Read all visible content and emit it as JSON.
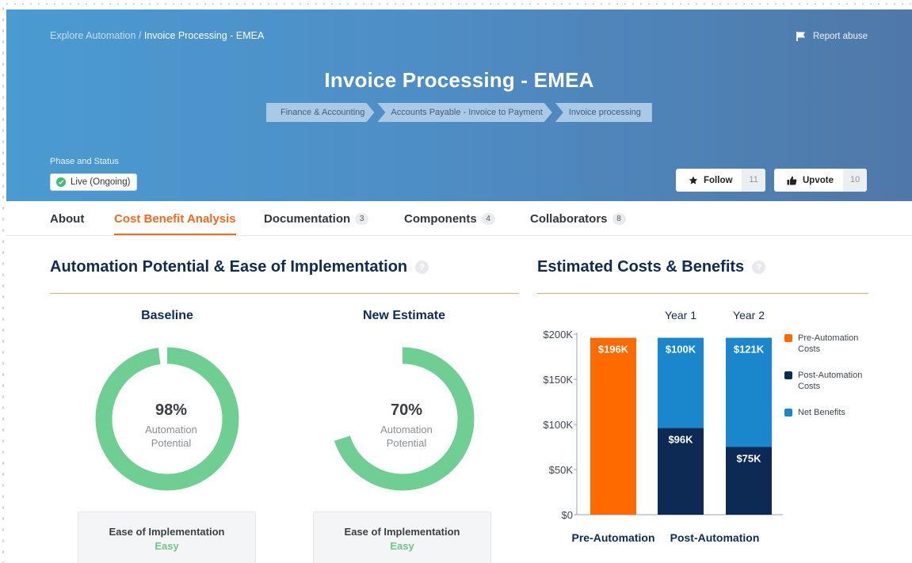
{
  "breadcrumb": {
    "parent": "Explore Automation /",
    "current": "Invoice Processing - EMEA"
  },
  "header": {
    "report_label": "Report abuse",
    "title": "Invoice Processing - EMEA",
    "category_path": [
      "Finance & Accounting",
      "Accounts Payable - Invoice to Payment",
      "Invoice processing"
    ],
    "phase_label": "Phase and Status",
    "status": "Live (Ongoing)",
    "follow": {
      "label": "Follow",
      "count": "11"
    },
    "upvote": {
      "label": "Upvote",
      "count": "10"
    }
  },
  "tabs": [
    {
      "label": "About",
      "badge": ""
    },
    {
      "label": "Cost Benefit Analysis",
      "badge": "",
      "active": true
    },
    {
      "label": "Documentation",
      "badge": "3"
    },
    {
      "label": "Components",
      "badge": "4"
    },
    {
      "label": "Collaborators",
      "badge": "8"
    }
  ],
  "potential": {
    "title": "Automation Potential & Ease of Implementation",
    "help": "?",
    "baseline": {
      "title": "Baseline",
      "percent_text": "98%",
      "percent": 98,
      "caption1": "Automation",
      "caption2": "Potential",
      "ease_label": "Ease of Implementation",
      "ease_value": "Easy"
    },
    "estimate": {
      "title": "New Estimate",
      "percent_text": "70%",
      "percent": 70,
      "caption1": "Automation",
      "caption2": "Potential",
      "ease_label": "Ease of Implementation",
      "ease_value": "Easy"
    }
  },
  "costs": {
    "title": "Estimated Costs & Benefits",
    "help": "?"
  },
  "colors": {
    "accent": "#f06a1c",
    "donut": "#6fcf93",
    "pre": "#ff6a00",
    "post": "#0d2a55",
    "net": "#1a86cc"
  },
  "chart_data": {
    "type": "bar",
    "stacked": true,
    "categories": [
      "Pre-Automation",
      "Year 1",
      "Year 2"
    ],
    "category_groups": [
      "Pre-Automation",
      "Post-Automation"
    ],
    "series": [
      {
        "name": "Pre-Automation Costs",
        "values": [
          196,
          0,
          0
        ],
        "labels": [
          "$196K",
          "",
          ""
        ]
      },
      {
        "name": "Post-Automation Costs",
        "values": [
          0,
          96,
          75
        ],
        "labels": [
          "",
          "$96K",
          "$75K"
        ]
      },
      {
        "name": "Net Benefits",
        "values": [
          0,
          100,
          121
        ],
        "labels": [
          "",
          "$100K",
          "$121K"
        ]
      }
    ],
    "ylim": [
      0,
      200
    ],
    "yticks": [
      "$0",
      "$50K",
      "$100K",
      "$150K",
      "$200K"
    ],
    "legend": "right"
  }
}
